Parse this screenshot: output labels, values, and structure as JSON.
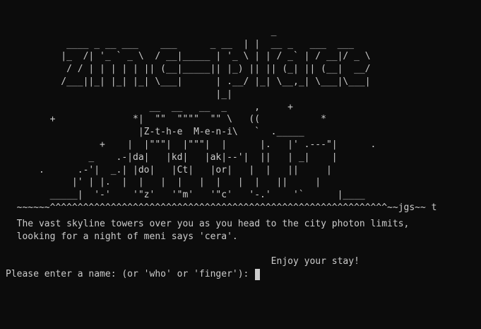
{
  "terminal": {
    "ascii_art": [
      "                                                ",
      "                                                _",
      "           ____ _ __ ___    ___      _ __  | |  __ _   ___  ___",
      "          |_  /| '_ ` _ \\  / __|_____ | '_ \\ | | / _` | / __|/ _ \\",
      "           / / | | | | | || (__|_____|| |_) || || (_| || (__|  __/",
      "          /___||_| |_| |_| \\___|      | .__/ |_| \\__,_| \\___|\\___|",
      "                                      |_|",
      "                          __  __   __  _     ,     +",
      "        +              *|  \"\"  \"\"\"\"  \"\" \\   ((           *",
      "                        |Z-t-h-e  M-e-n-i\\   `  ._____",
      "                 +    |  |\"\"\"|  |\"\"\"|  |      |.   |' .---\"|      .",
      "               _    .-|da|   |kd|   |ak|--'|  ||   | _|    |",
      "      .      .-'|  _.| |do|   |Ct|   |or|   |  |   ||     |",
      "            |' | |.  |  |   |  |   |  |   |  |   ||     |",
      "        _____|  '-'    '\"z'   '\"m'   '\"c'   '-.'    '`      |____",
      "  ~~~~~~^^^^^^^^^^^^^^^^^^^^^^^^^^^^^^^^^^^^^^^^^^^^^^^^^^^^^^^^^^^^^~~jgs~~ t"
    ],
    "description_lines": [
      "  The vast skyline towers over you as you head to the city photon limits,",
      "  looking for a night of meni says 'cera'.",
      "",
      "                                                Enjoy your stay!"
    ],
    "prompt_text": "Please enter a name: (or 'who' or 'finger'): ",
    "input_value": ""
  },
  "colors": {
    "background": "#0c0c0c",
    "foreground": "#cccccc"
  }
}
